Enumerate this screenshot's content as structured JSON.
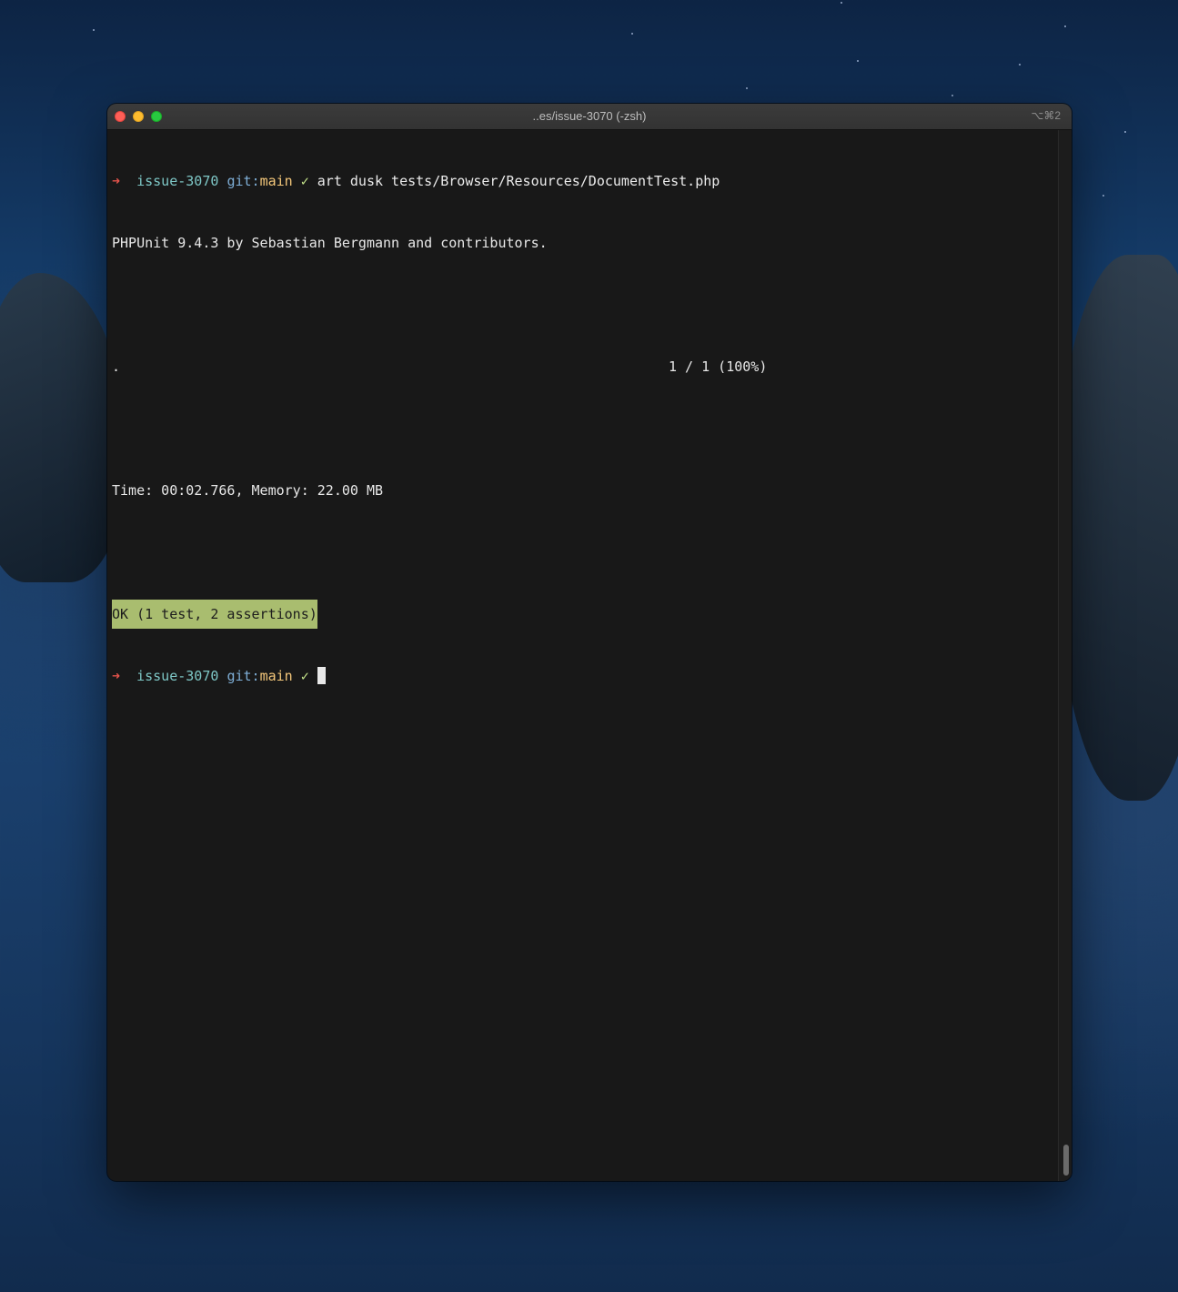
{
  "window": {
    "title": "..es/issue-3070 (-zsh)",
    "shortcut": "⌥⌘2"
  },
  "prompt": {
    "arrow": "➜",
    "directory": "issue-3070",
    "git_prefix": "git:",
    "branch": "main",
    "clean_mark": "✓"
  },
  "terminal": {
    "command": "art dusk tests/Browser/Resources/DocumentTest.php",
    "phpunit_header": "PHPUnit 9.4.3 by Sebastian Bergmann and contributors.",
    "progress_dots": ".",
    "progress_count": "1 / 1 (100%)",
    "time_memory": "Time: 00:02.766, Memory: 22.00 MB",
    "result_banner": "OK (1 test, 2 assertions)"
  },
  "colors": {
    "terminal_bg": "#181818",
    "ok_banner_bg": "#a9bd6f",
    "arrow": "#e5534b",
    "directory": "#7ec7c6",
    "branch": "#f4c77a"
  }
}
